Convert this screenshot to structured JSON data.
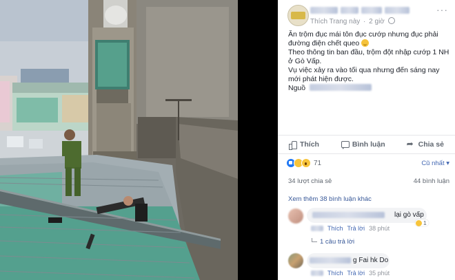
{
  "post": {
    "meta_link": "Thích Trang này",
    "meta_dot": "·",
    "time": "2 giờ",
    "more": "···",
    "text_line1": "Ăn trộm đục mái tôn đục cướp nhưng đục phải đường điện chết queo",
    "text_line2": "Theo thông tin ban đầu, trộm đột nhập cướp 1 NH ở Gò Vấp.",
    "text_line3": "Vụ việc xảy ra vào tối qua nhưng đến sáng nay mới phát hiện được.",
    "source_prefix": "Nguồ"
  },
  "actions": {
    "like_label": "Thích",
    "comment_label": "Bình luận",
    "share_label": "Chia sẻ"
  },
  "reactions": {
    "count": "71",
    "sort_label": "Cũ nhất ▾"
  },
  "stats": {
    "shares": "34 lượt chia sẻ",
    "comments": "44 bình luận"
  },
  "comments": {
    "view_more": "Xem thêm 38 bình luận khác",
    "c1_text": "lại gò vấp",
    "c1_reaction_count": "1",
    "c1_like": "Thích",
    "c1_reply": "Trả lời",
    "c1_time": "38 phút",
    "c1_replies": "1 câu trả lời",
    "c2_text": "g Fai hk Do",
    "c2_like": "Thích",
    "c2_reply": "Trả lời",
    "c2_time": "35 phút"
  },
  "colors": {
    "accent": "#4267b2",
    "link": "#385898",
    "meta": "#90949c",
    "roof": "#5aa090"
  }
}
